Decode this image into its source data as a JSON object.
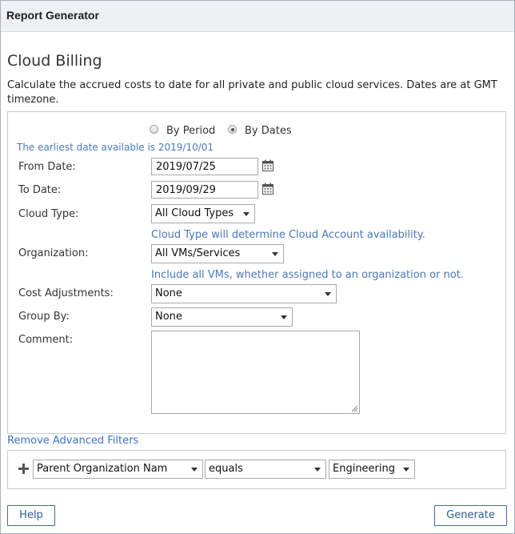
{
  "window": {
    "title": "Report Generator"
  },
  "page": {
    "title": "Cloud Billing",
    "description": "Calculate the accrued costs to date for all private and public cloud services. Dates are at GMT timezone."
  },
  "form": {
    "mode_options": [
      {
        "label": "By Period",
        "checked": false
      },
      {
        "label": "By Dates",
        "checked": true
      }
    ],
    "earliest_date_note": "The earliest date available is 2019/10/01",
    "from_date": {
      "label": "From Date:",
      "value": "2019/07/25"
    },
    "to_date": {
      "label": "To Date:",
      "value": "2019/09/29"
    },
    "cloud_type": {
      "label": "Cloud Type:",
      "value": "All Cloud Types",
      "hint": "Cloud Type will determine Cloud Account availability."
    },
    "organization": {
      "label": "Organization:",
      "value": "All VMs/Services",
      "hint": "Include all VMs, whether assigned to an organization or not."
    },
    "cost_adjustments": {
      "label": "Cost Adjustments:",
      "value": "None"
    },
    "group_by": {
      "label": "Group By:",
      "value": "None"
    },
    "comment": {
      "label": "Comment:",
      "value": ""
    }
  },
  "advanced_filters": {
    "toggle_label": "Remove Advanced Filters",
    "filter": {
      "field": "Parent Organization Nam",
      "operator": "equals",
      "value": "Engineering"
    }
  },
  "footer": {
    "help_label": "Help",
    "generate_label": "Generate"
  },
  "colors": {
    "link": "#3b73c6",
    "hint": "#4a78b8",
    "button_border": "#3c6ea8"
  },
  "icons": [
    "calendar-icon",
    "plus-icon",
    "chevron-down-icon",
    "resize-grip-icon"
  ]
}
